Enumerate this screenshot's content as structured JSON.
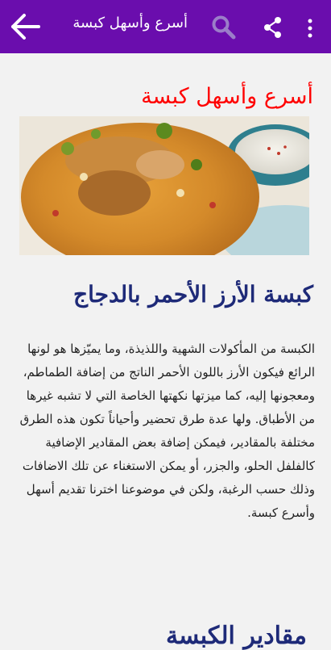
{
  "appbar": {
    "title": "أسرع وأسهل كبسة",
    "back_icon": "arrow-left-icon",
    "search_icon": "search-icon",
    "share_icon": "share-icon",
    "more_icon": "more-vert-icon",
    "color": "#6a0dad"
  },
  "article": {
    "heading": "أسرع وأسهل كبسة",
    "image": "kabsa-chicken-rice-photo",
    "subheading": "كبسة الأرز الأحمر بالدجاج",
    "paragraph": "الكبسة من المأكولات الشهية واللذيذة، وما يميّزها هو لونها الرائع فيكون الأرز باللون الأحمر الناتج من إضافة الطماطم، ومعجونها إليه، كما ميزتها نكهتها الخاصة التي لا تشبه غيرها من الأطباق. ولها عدة طرق تحضير وأحياناً تكون هذه الطرق مختلفة بالمقادير، فيمكن إضافة بعض المقادير الإضافية كالفلفل الحلو، والجزر، أو يمكن الاستغناء عن تلك الاضافات وذلك حسب الرغبة، ولكن في موضوعنا اخترنا تقديم أسهل وأسرع كبسة.",
    "next_heading": "مقادير الكبسة"
  },
  "colors": {
    "heading_red": "#ff0000",
    "heading_blue": "#1e2a78"
  }
}
